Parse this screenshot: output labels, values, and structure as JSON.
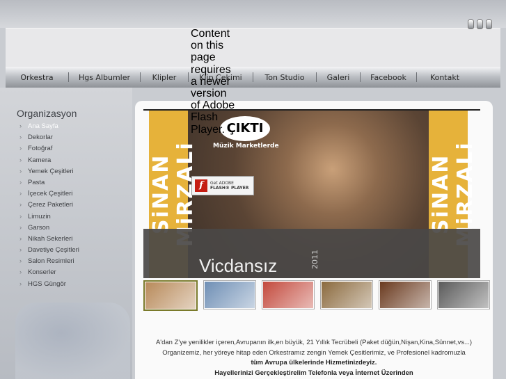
{
  "nav": {
    "items": [
      "Orkestra",
      "Hgs Albumler",
      "Klipler",
      "Klip Cekimi",
      "Ton Studio",
      "Galeri",
      "Facebook",
      "Kontakt"
    ]
  },
  "flash": {
    "message": "Content on this page requires a newer version of Adobe Flash Player.",
    "badge_line1": "Get ADOBE",
    "badge_line2": "FLASH® PLAYER"
  },
  "sidebar": {
    "title": "Organizasyon",
    "items": [
      {
        "label": "Ana Sayfa",
        "active": true
      },
      {
        "label": "Dekorlar"
      },
      {
        "label": "Fotoğraf"
      },
      {
        "label": "Kamera"
      },
      {
        "label": "Yemek Çeşitleri"
      },
      {
        "label": "Pasta"
      },
      {
        "label": "İçecek Çeşitleri"
      },
      {
        "label": "Çerez Paketleri"
      },
      {
        "label": "Limuzin"
      },
      {
        "label": "Garson"
      },
      {
        "label": "Nikah Sekerleri"
      },
      {
        "label": "Davetiye Çeşitleri"
      },
      {
        "label": "Salon Resimleri"
      },
      {
        "label": "Konserler"
      },
      {
        "label": "HGS Güngör"
      }
    ]
  },
  "banner": {
    "artist_left": "SiNAN MiRZALi",
    "artist_right": "SiNAN MiRZALi",
    "headline": "ÇIKTI",
    "sub": "Müzik Marketlerde",
    "album": "Vicdansız",
    "year": "2011"
  },
  "thumbs": {
    "colors": [
      "#b88a5a",
      "#6f8fb5",
      "#c34a3d",
      "#8b6a3e",
      "#6a3a1f",
      "#5a5a5a"
    ]
  },
  "description": {
    "line1": "A'dan Z'ye yenilikler içeren,Avrupanın ilk,en büyük, 21 Yıllık Tecrübeli (Paket düğün,Nişan,Kina,Sünnet,vs...)",
    "line2": "Organizemiz, her yöreye hitap eden Orkestramız zengin Yemek Çesitlerimiz, ve Profesionel kadromuzla",
    "line3": "tüm Avrupa ülkelerinde Hizmetinizdeyiz.",
    "line4": "Hayellerinizi Gerçekleştirelim Telefonla veya İnternet Üzerinden"
  }
}
